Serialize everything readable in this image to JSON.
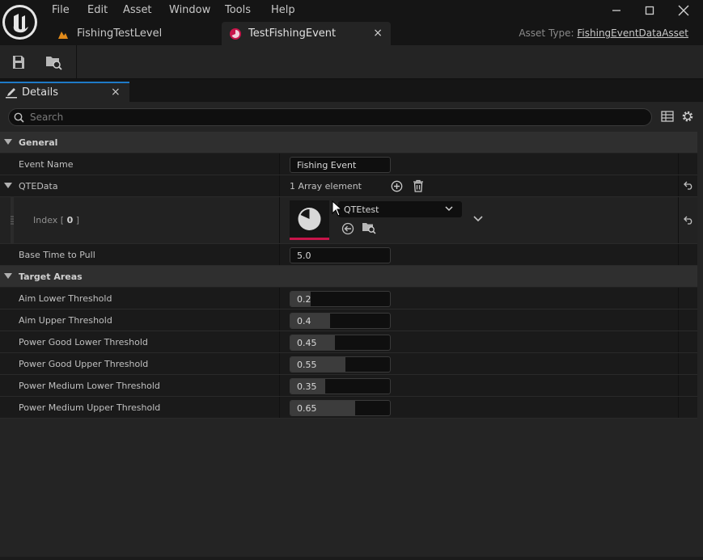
{
  "menu": [
    "File",
    "Edit",
    "Asset",
    "Window",
    "Tools",
    "Help"
  ],
  "tabs": {
    "level": "FishingTestLevel",
    "event": "TestFishingEvent",
    "close_glyph": "×"
  },
  "asset_type": {
    "label": "Asset Type:",
    "value": "FishingEventDataAsset"
  },
  "panel": {
    "title": "Details",
    "close_glyph": "×"
  },
  "search": {
    "placeholder": "Search"
  },
  "categories": {
    "general": "General",
    "target_areas": "Target Areas"
  },
  "properties": {
    "event_name": {
      "label": "Event Name",
      "value": "Fishing Event"
    },
    "qte_data": {
      "label": "QTEData",
      "count": "1 Array element"
    },
    "index": {
      "label_pre": "Index [ ",
      "index": "0",
      "label_post": " ]",
      "asset": "QTEtest"
    },
    "base_time": {
      "label": "Base Time to Pull",
      "value": "5.0"
    }
  },
  "thresholds": [
    {
      "label": "Aim Lower Threshold",
      "value": "0.2",
      "fraction": 0.2
    },
    {
      "label": "Aim Upper Threshold",
      "value": "0.4",
      "fraction": 0.4
    },
    {
      "label": "Power Good Lower Threshold",
      "value": "0.45",
      "fraction": 0.45
    },
    {
      "label": "Power Good Upper Threshold",
      "value": "0.55",
      "fraction": 0.55
    },
    {
      "label": "Power Medium Lower Threshold",
      "value": "0.35",
      "fraction": 0.35
    },
    {
      "label": "Power Medium Upper Threshold",
      "value": "0.65",
      "fraction": 0.65
    }
  ],
  "colors": {
    "accent_tab": "#1f7ac7",
    "asset_accent": "#c8154a",
    "level_icon": "#e08a1a"
  }
}
